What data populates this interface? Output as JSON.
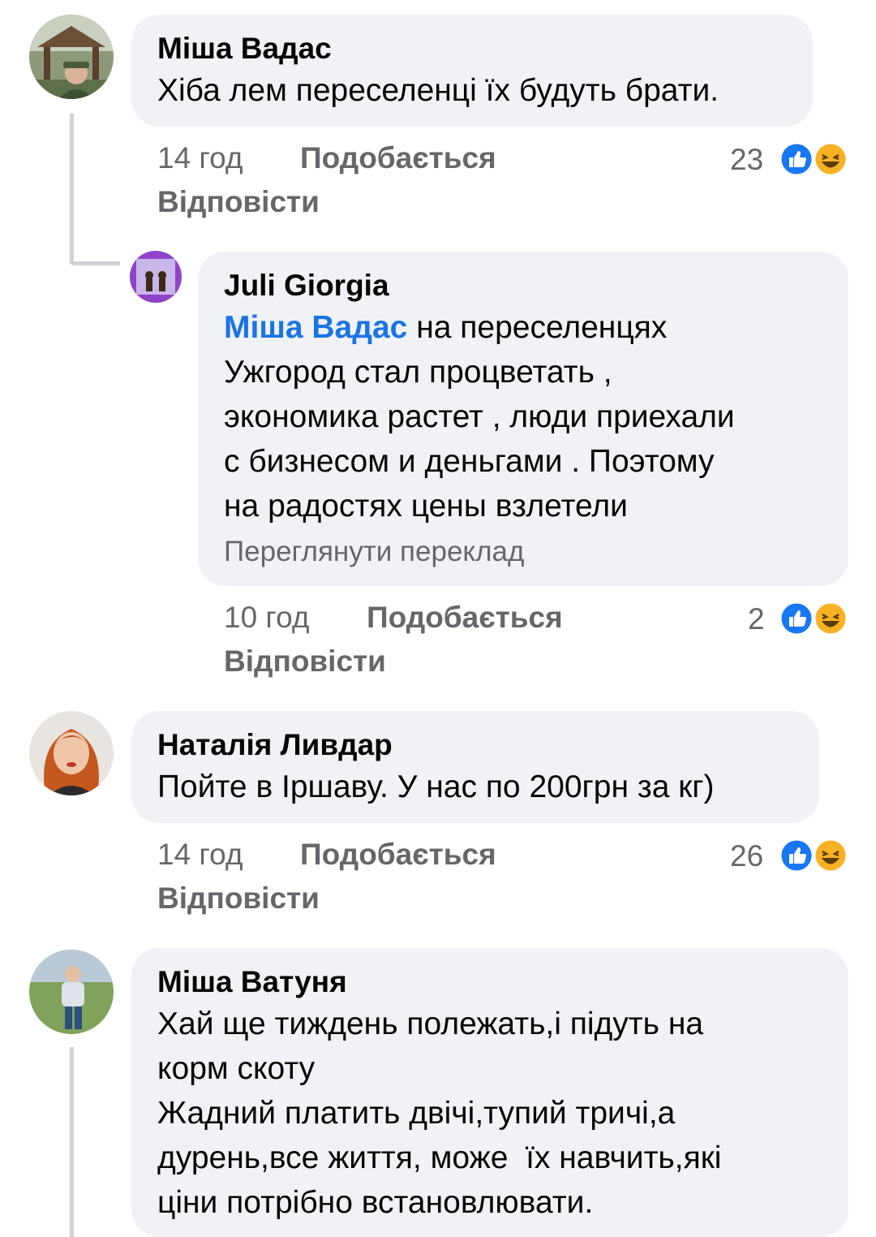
{
  "comments": [
    {
      "author": "Міша Вадас",
      "text": "Хіба лем переселенці їх будуть брати.",
      "time": "14 год",
      "like_label": "Подобається",
      "reply_label": "Відповісти",
      "reaction_count": "23"
    },
    {
      "author": "Juli Giorgia",
      "mention": "Міша Вадас",
      "text_lines": [
        " на переселенцях",
        "Ужгород стал процветать ,",
        "экономика растет , люди приехали",
        "с бизнесом и деньгами . Поэтому",
        "на радостях цены взлетели"
      ],
      "translate_label": "Переглянути переклад",
      "time": "10 год",
      "like_label": "Подобається",
      "reply_label": "Відповісти",
      "reaction_count": "2"
    },
    {
      "author": "Наталія Ливдар",
      "text": "Пойте в Іршаву. У нас по 200грн за кг)",
      "time": "14 год",
      "like_label": "Подобається",
      "reply_label": "Відповісти",
      "reaction_count": "26"
    },
    {
      "author": "Міша Ватуня",
      "text_lines": [
        "Хай ще тиждень полежать,і підуть на",
        "корм скоту",
        "Жадний платить двічі,тупий тричі,а",
        "дурень,все життя, може  їх навчить,які",
        "ціни потрібно встановлювати."
      ]
    }
  ],
  "icons": {
    "like": "like-reaction-icon",
    "haha": "haha-reaction-icon"
  },
  "colors": {
    "bubble": "#f0f2f5",
    "mention": "#1b74e4",
    "meta": "#65676b",
    "like_blue": "#1877f2",
    "haha_yellow": "#f7b125"
  }
}
